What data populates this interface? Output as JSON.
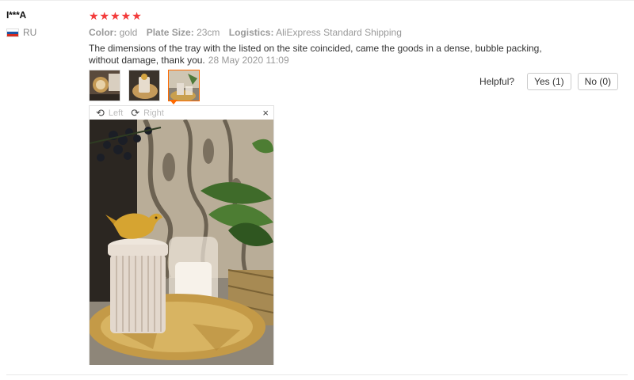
{
  "user": {
    "name": "I***A",
    "country": "RU"
  },
  "review": {
    "stars": "★★★★★",
    "color_key": "Color:",
    "color_val": "gold",
    "plate_key": "Plate Size:",
    "plate_val": "23cm",
    "log_key": "Logistics:",
    "log_val": "AliExpress Standard Shipping",
    "text": "The dimensions of the tray with the listed on the site coincided, came the goods in a dense, bubble packing, without damage, thank you.",
    "date": "28 May 2020 11:09"
  },
  "helpful": {
    "label": "Helpful?",
    "yes": "Yes (1)",
    "no": "No (0)"
  },
  "viewer": {
    "left": "Left",
    "right": "Right",
    "close": "×"
  },
  "colors": {
    "star": "#f33b3b",
    "accent": "#ff6a00"
  }
}
